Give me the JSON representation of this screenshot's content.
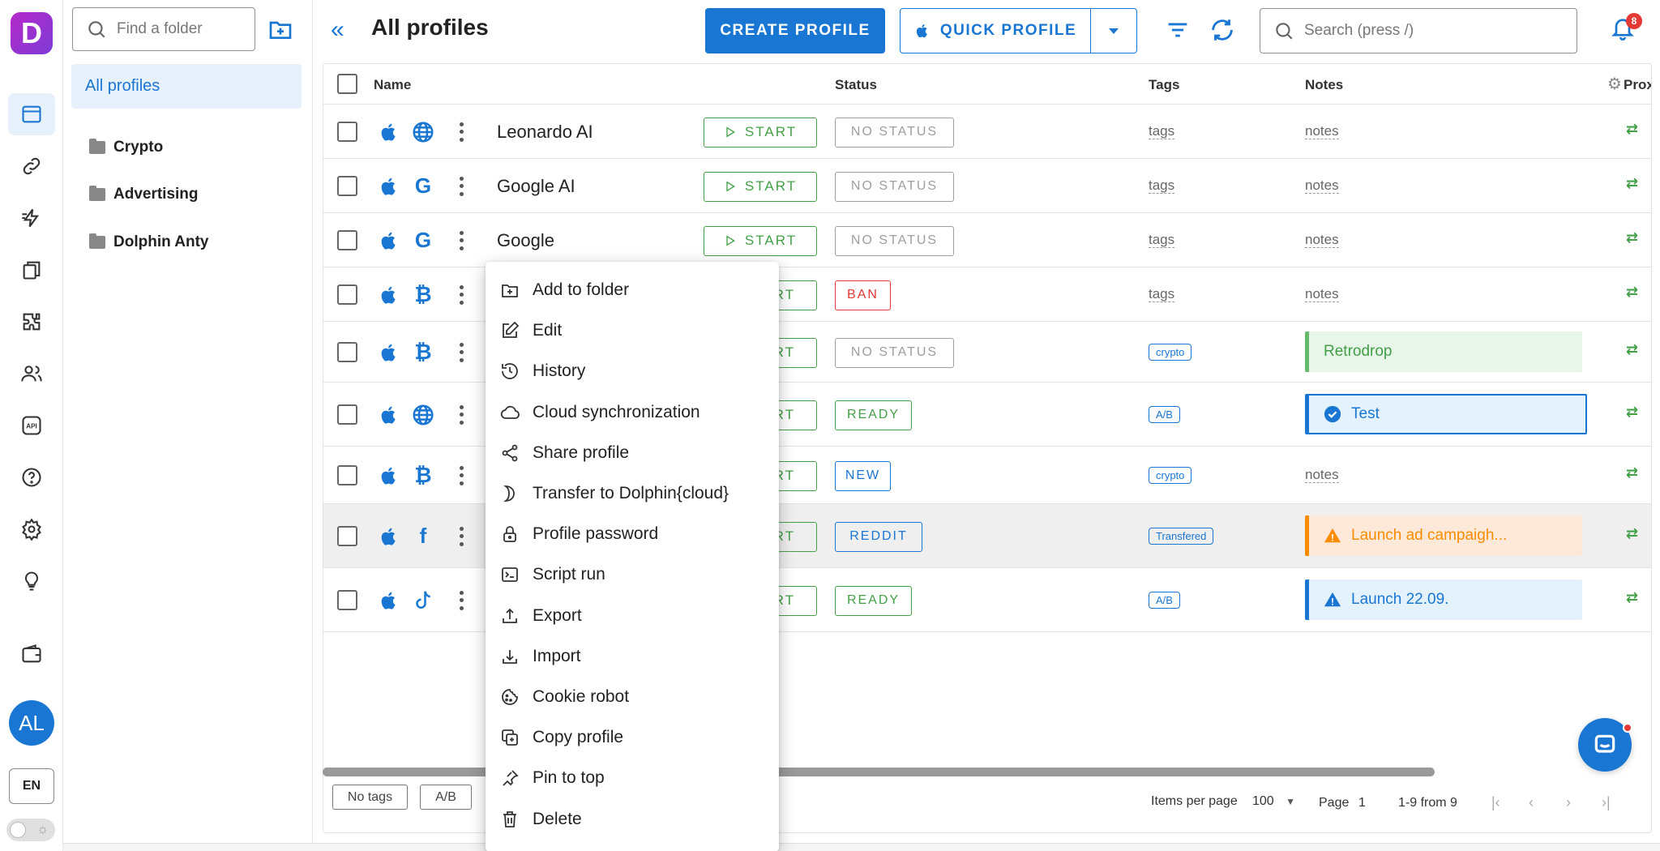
{
  "app": {
    "logo_letter": "D",
    "avatar_initials": "AL",
    "language": "EN",
    "notification_count": "8"
  },
  "sidebar_rail": {
    "items": [
      "browser-profiles",
      "proxies",
      "automation",
      "bookmarks",
      "extensions",
      "users",
      "api",
      "help",
      "settings",
      "ideas",
      "wallet"
    ]
  },
  "folders": {
    "search_placeholder": "Find a folder",
    "all_label": "All profiles",
    "items": [
      "Crypto",
      "Advertising",
      "Dolphin Anty"
    ]
  },
  "header": {
    "title": "All profiles",
    "create_label": "CREATE PROFILE",
    "quick_label": "QUICK PROFILE",
    "search_placeholder": "Search (press /)"
  },
  "table": {
    "columns": {
      "name": "Name",
      "status": "Status",
      "tags": "Tags",
      "notes": "Notes",
      "proxy": "Prox"
    },
    "start_label": "START",
    "rows": [
      {
        "name": "Leonardo AI",
        "browser": "globe",
        "status": "NO STATUS",
        "status_color": "#9e9e9e",
        "tag": "tags",
        "note": "notes"
      },
      {
        "name": "Google AI",
        "browser": "google",
        "status": "NO STATUS",
        "status_color": "#9e9e9e",
        "tag": "tags",
        "note": "notes"
      },
      {
        "name": "Google",
        "browser": "google",
        "status": "NO STATUS",
        "status_color": "#9e9e9e",
        "tag": "tags",
        "note": "notes"
      },
      {
        "name": "",
        "browser": "bitcoin",
        "start_partial": "RT",
        "status": "BAN",
        "status_color": "#e53935",
        "tag": "tags",
        "note": "notes"
      },
      {
        "name": "",
        "browser": "bitcoin",
        "start_partial": "RT",
        "status": "NO STATUS",
        "status_color": "#9e9e9e",
        "tag": "crypto",
        "note": "Retrodrop"
      },
      {
        "name": "",
        "browser": "globe",
        "start_partial": "RT",
        "status": "READY",
        "status_color": "#43a047",
        "tag": "A/B",
        "note": "Test"
      },
      {
        "name": "",
        "browser": "bitcoin",
        "start_partial": "RT",
        "status": "NEW",
        "status_color": "#1976d2",
        "tag": "crypto",
        "note": "notes"
      },
      {
        "name": "",
        "browser": "facebook",
        "start_partial": "RT",
        "status": "REDDIT",
        "status_color": "#1976d2",
        "tag": "Transfered",
        "note": "Launch ad campaigh..."
      },
      {
        "name": "",
        "browser": "tiktok",
        "start_partial": "RT",
        "status": "READY",
        "status_color": "#43a047",
        "tag": "A/B",
        "note": "Launch 22.09."
      }
    ]
  },
  "footer": {
    "tag_filters": [
      "No tags",
      "A/B"
    ],
    "items_per_page_label": "Items per page",
    "items_per_page_value": "100",
    "page_label": "Page",
    "page_value": "1",
    "range_label": "1-9 from 9"
  },
  "context_menu": {
    "items": [
      "Add to folder",
      "Edit",
      "History",
      "Cloud synchronization",
      "Share profile",
      "Transfer to Dolphin{cloud}",
      "Profile password",
      "Script run",
      "Export",
      "Import",
      "Cookie robot",
      "Copy profile",
      "Pin to top",
      "Delete"
    ]
  },
  "colors": {
    "accent": "#1976d2",
    "success": "#43a047",
    "danger": "#e53935",
    "warning": "#fb8c00"
  }
}
